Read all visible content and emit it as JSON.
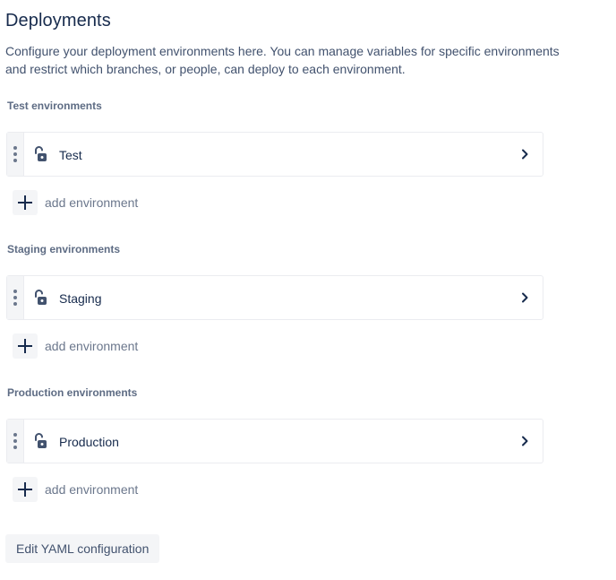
{
  "page": {
    "title": "Deployments",
    "description": "Configure your deployment environments here. You can manage variables for specific environments and restrict which branches, or people, can deploy to each environment."
  },
  "sections": [
    {
      "heading": "Test environments",
      "environments": [
        {
          "name": "Test",
          "lock_icon": "unlocked-padlock-icon",
          "chevron_icon": "chevron-right-icon"
        }
      ],
      "add_label": "add environment"
    },
    {
      "heading": "Staging environments",
      "environments": [
        {
          "name": "Staging",
          "lock_icon": "unlocked-padlock-icon",
          "chevron_icon": "chevron-right-icon"
        }
      ],
      "add_label": "add environment"
    },
    {
      "heading": "Production environments",
      "environments": [
        {
          "name": "Production",
          "lock_icon": "unlocked-padlock-icon",
          "chevron_icon": "chevron-right-icon"
        }
      ],
      "add_label": "add environment"
    }
  ],
  "footer": {
    "edit_yaml_label": "Edit YAML configuration"
  },
  "colors": {
    "text_primary": "#172b4d",
    "text_secondary": "#42526e",
    "text_subtle": "#6b778c",
    "heading_muted": "#5e6c84",
    "surface_neutral": "#f4f5f7",
    "border": "#ebecf0"
  }
}
